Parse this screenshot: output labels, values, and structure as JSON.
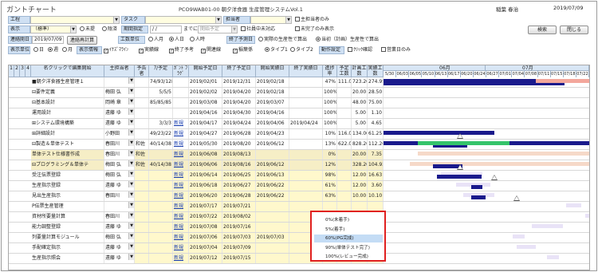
{
  "app_title": "ガントチャート",
  "system_title": "PCO9WAB01-00 朝夕洋食器 生産管理システムVol.1",
  "user": "稲葉 春治",
  "date": "2019/07/09",
  "filters": {
    "kouji_label": "工程",
    "task_label": "タスク",
    "tantou_label": "担当者",
    "main_tantou": "主担当者のみ",
    "hyoji_label": "表示",
    "hyoji_value": "（標準）",
    "mitei": "未提",
    "yotei": "陰済",
    "kikan_label": "期間指定",
    "kikan_from": "/ /",
    "kikan_to_label": "までに",
    "kikan_start_placeholder": "開始予定",
    "shain_sakusei": "社員中未対応",
    "mikan_only": "未完了のみ表示",
    "search_btn": "検索",
    "close_btn": "閉じる",
    "renketsu_label": "連絡開日",
    "renketsu_date": "2019/07/09",
    "renketsu_btn": "連絡再計算",
    "kousuu_label": "工数単位",
    "kousuu_hito": "人月",
    "kousuu_hi": "人日",
    "kousuu_ji": "人時",
    "shuryo_label": "終了予測日",
    "shuryo_opt1": "実際の生産性で算出",
    "shuryo_opt2": "当初（計画）生産性で算出",
    "tani_label": "表示単位",
    "tani_day": "日",
    "tani_week": "週",
    "tani_month": "月",
    "hyoji_jouhou": "表示情報",
    "opt_inazuma": "ｲﾅｽﾞﾏﾗｲﾝ",
    "opt_jisseki": "実績線",
    "opt_shuryo": "終了予考",
    "opt_kanren": "関連線",
    "opt_renkei": "稲葉係",
    "opt_type1": "タイプ1",
    "opt_type2": "タイプ2",
    "dousa_settei": "動作設定",
    "opt_iriyo": "ｸﾘｯｸ確認",
    "opt_eigyoubi": "営業日のみ"
  },
  "grid": {
    "headers": {
      "lv": [
        "1",
        "2",
        "3",
        "4"
      ],
      "name": "名クリックで編集開始",
      "tantou": "主担当者",
      "yosan": "予告者",
      "a_t": "ｱ/予定",
      "gantt": "ｶﾞﾝﾄ ﾌﾗｸﾞ",
      "kaishi_yotei": "開始予定日",
      "shuryo_yotei": "終了予定日",
      "kaishi_jisseki": "開始実績日",
      "shuryo_jisseki": "終了実績日",
      "shinchoku": "進捗率",
      "yotei_kousuu": "予定工数",
      "keikaku_kousuu": "計画工数",
      "jisseki_kousuu": "実績工数"
    },
    "gantt_months": [
      "06月",
      "07月"
    ],
    "gantt_days": [
      "5/30",
      "06/03",
      "06/05",
      "05/10",
      "06/13",
      "06/17",
      "06/20",
      "06/24",
      "06/27",
      "07/01",
      "07/04",
      "07/08",
      "07/11",
      "07/15",
      "07/18",
      "07/22"
    ],
    "rows": [
      {
        "name": "■朝夕洋食器生産管理１",
        "tantou": "",
        "yosan": "",
        "a_t": "74/93/128",
        "gantt": "",
        "ks": "2019/02/01",
        "ke": "2019/12/31",
        "js": "2019/02/18",
        "je": "",
        "pct": "47%",
        "yk": "111.00",
        "kk": "723.20",
        "jk": "274.95",
        "style": "white"
      },
      {
        "name": "⊟要件定義",
        "tantou": "梅田 弘",
        "yosan": "",
        "a_t": "5/5/5",
        "gantt": "",
        "ks": "2019/02/02",
        "ke": "2019/04/20",
        "js": "2019/02/18",
        "je": "",
        "pct": "100%",
        "yk": "",
        "kk": "20.00",
        "jk": "28.50",
        "style": "white"
      },
      {
        "name": "⊟基本設計",
        "tantou": "岡崎 章",
        "yosan": "",
        "a_t": "85/85/85",
        "gantt": "",
        "ks": "2019/03/08",
        "ke": "2019/04/20",
        "js": "2019/03/07",
        "je": "",
        "pct": "100%",
        "yk": "",
        "kk": "48.00",
        "jk": "75.00",
        "style": "white"
      },
      {
        "name": "運用設計",
        "tantou": "遠藤 ゆ",
        "yosan": "",
        "a_t": "",
        "gantt": "",
        "ks": "2019/04/16",
        "ke": "2019/04/30",
        "js": "2019/04/16",
        "je": "",
        "pct": "100%",
        "yk": "",
        "kk": "5.00",
        "jk": "1.10",
        "style": "white"
      },
      {
        "name": "⊞システム環境構築",
        "tantou": "遠藤 ゆ",
        "yosan": "",
        "a_t": "3/3/3",
        "gantt": "新規",
        "ks": "2019/04/17",
        "ke": "2019/04/24",
        "js": "2019/04/06",
        "je": "2019/04/24",
        "pct": "100%",
        "yk": "",
        "kk": "5.00",
        "jk": "4.65",
        "style": "white"
      },
      {
        "name": "⊞詳細設計",
        "tantou": "小野田",
        "yosan": "",
        "a_t": "49/23/22",
        "gantt": "新規",
        "ks": "2019/04/27",
        "ke": "2019/06/28",
        "js": "2019/04/23",
        "je": "",
        "pct": "10%",
        "yk": "116.00",
        "kk": "134.00",
        "jk": "61.25",
        "style": "white"
      },
      {
        "name": "⊟製造＆単体テスト",
        "tantou": "春田川",
        "yosan": "和佐",
        "a_t": "40/14/38",
        "gantt": "新規",
        "ks": "2019/05/30",
        "ke": "2019/08/20",
        "js": "2019/06/12",
        "je": "",
        "pct": "13%",
        "yk": "622.00",
        "kk": "828.20",
        "jk": "112.26",
        "style": "white"
      },
      {
        "name": "単体テスト仕様書作成",
        "tantou": "春田川",
        "yosan": "和佐",
        "a_t": "",
        "gantt": "新規",
        "ks": "2019/06/08",
        "ke": "2019/08/13",
        "js": "",
        "je": "",
        "pct": "0%",
        "yk": "",
        "kk": "20.00",
        "jk": "7.35",
        "style": "tan"
      },
      {
        "name": "⊟プログラミング＆単体テ",
        "tantou": "梅田 弘",
        "yosan": "和佐",
        "a_t": "40/14/38",
        "gantt": "新規",
        "ks": "2019/06/06",
        "ke": "2019/08/16",
        "js": "2019/06/12",
        "je": "",
        "pct": "12%",
        "yk": "",
        "kk": "328.20",
        "jk": "104.93",
        "style": "tan"
      },
      {
        "name": "受注伝票登録",
        "tantou": "梅田 弘",
        "yosan": "",
        "a_t": "",
        "gantt": "新規",
        "ks": "2019/06/14",
        "ke": "2019/06/25",
        "js": "2019/06/13",
        "je": "",
        "pct": "98%",
        "yk": "",
        "kk": "12.00",
        "jk": "16.63",
        "style": "yel"
      },
      {
        "name": "生産指示登録",
        "tantou": "遠藤 ゆ",
        "yosan": "",
        "a_t": "",
        "gantt": "新規",
        "ks": "2019/06/18",
        "ke": "2019/06/27",
        "js": "2019/06/22",
        "je": "",
        "pct": "61%",
        "yk": "",
        "kk": "12.00",
        "jk": "3.60",
        "style": "yel"
      },
      {
        "name": "見出生産指示",
        "tantou": "春田川",
        "yosan": "",
        "a_t": "",
        "gantt": "新規",
        "ks": "2019/06/20",
        "ke": "2019/06/28",
        "js": "2019/06/22",
        "je": "",
        "pct": "63%",
        "yk": "",
        "kk": "10.00",
        "jk": "10.10",
        "style": "yel"
      },
      {
        "name": "P伝票生産管理",
        "tantou": "",
        "yosan": "",
        "a_t": "",
        "gantt": "新規",
        "ks": "2019/07/17",
        "ke": "2019/07/21",
        "js": "",
        "je": "",
        "pct": "",
        "yk": "",
        "kk": "",
        "jk": "",
        "style": "yel"
      },
      {
        "name": "資材所要量計算",
        "tantou": "春田川",
        "yosan": "",
        "a_t": "",
        "gantt": "新規",
        "ks": "2019/07/22",
        "ke": "2019/08/02",
        "js": "",
        "je": "",
        "pct": "",
        "yk": "",
        "kk": "",
        "jk": "",
        "style": "yel"
      },
      {
        "name": "能力調整登録",
        "tantou": "遠藤 ゆ",
        "yosan": "",
        "a_t": "",
        "gantt": "新規",
        "ks": "2019/07/08",
        "ke": "2019/07/16",
        "js": "",
        "je": "",
        "pct": "",
        "yk": "",
        "kk": "",
        "jk": "",
        "style": "yel"
      },
      {
        "name": "列要量計算モジュール",
        "tantou": "梅田 弘",
        "yosan": "",
        "a_t": "",
        "gantt": "新規",
        "ks": "2019/07/06",
        "ke": "2019/07/03",
        "js": "2019/07/03",
        "je": "",
        "pct": "",
        "yk": "",
        "kk": "",
        "jk": "",
        "style": "yel"
      },
      {
        "name": "手配確定指示",
        "tantou": "遠藤 ゆ",
        "yosan": "",
        "a_t": "",
        "gantt": "新規",
        "ks": "2019/07/04",
        "ke": "2019/07/09",
        "js": "",
        "je": "",
        "pct": "",
        "yk": "",
        "kk": "",
        "jk": "",
        "style": "yel"
      },
      {
        "name": "生産指示照会",
        "tantou": "遠藤 ゆ",
        "yosan": "",
        "a_t": "",
        "gantt": "新規",
        "ks": "2019/07/12",
        "ke": "2019/07/15",
        "js": "",
        "je": "",
        "pct": "",
        "yk": "",
        "kk": "3.20",
        "jk": "2.45",
        "style": "yel"
      }
    ]
  },
  "progress_popup": {
    "items": [
      "0%(未着手)",
      "5%(着手)",
      "60%(PG完成)",
      "90%(単体テスト完了)",
      "100%(レビュー完成)"
    ],
    "selected_index": 2
  },
  "colors": {
    "bar_plan": "#1a1a8c",
    "bar_actual": "#f3a79c",
    "bar_green": "#35c46a",
    "bar_tan": "#f6d9c8",
    "bar_pale": "#e9e3f7",
    "popup_border": "#e02020"
  }
}
